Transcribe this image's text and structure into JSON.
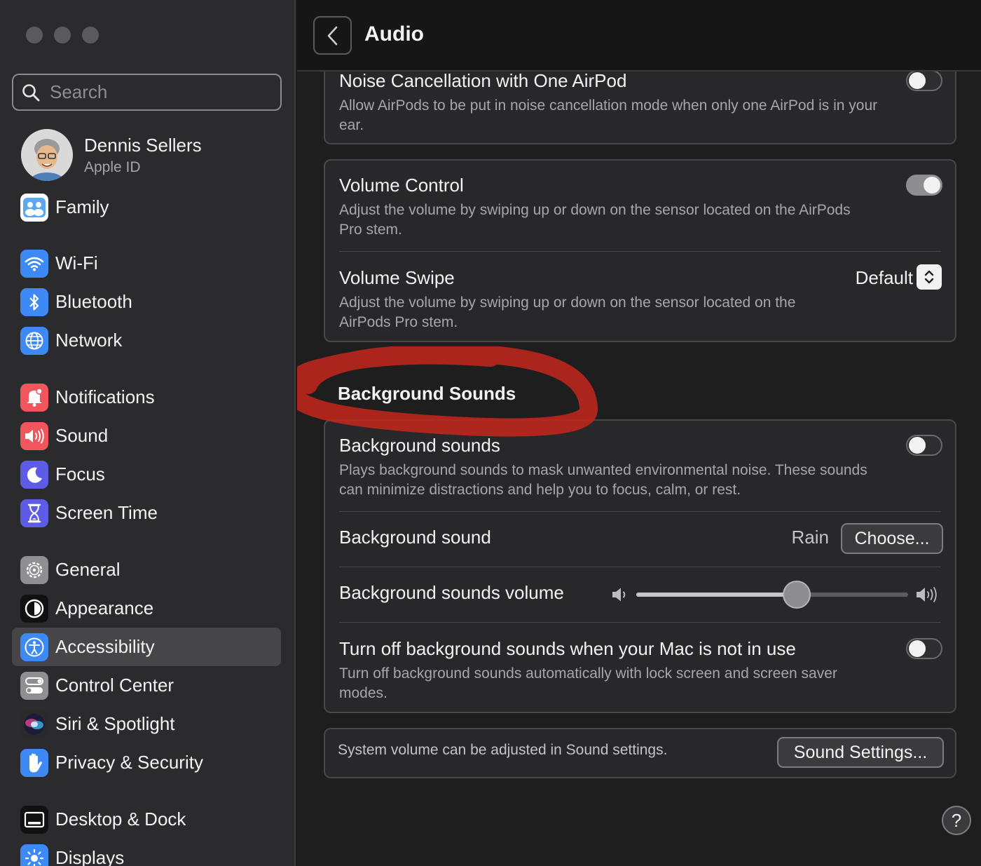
{
  "window": {
    "traffic_lights": [
      "close",
      "minimize",
      "zoom"
    ]
  },
  "sidebar": {
    "search_placeholder": "Search",
    "profile": {
      "name": "Dennis Sellers",
      "subtitle": "Apple ID"
    },
    "items": [
      {
        "label": "Family",
        "icon": "family-icon",
        "color": "#4a9df5"
      },
      {
        "label": "Wi-Fi",
        "icon": "wifi-icon",
        "color": "#3d8af7"
      },
      {
        "label": "Bluetooth",
        "icon": "bluetooth-icon",
        "color": "#3d8af7"
      },
      {
        "label": "Network",
        "icon": "globe-icon",
        "color": "#3d8af7"
      },
      {
        "label": "Notifications",
        "icon": "bell-icon",
        "color": "#f0565b"
      },
      {
        "label": "Sound",
        "icon": "speaker-icon",
        "color": "#f0565b"
      },
      {
        "label": "Focus",
        "icon": "moon-icon",
        "color": "#5e5ce6"
      },
      {
        "label": "Screen Time",
        "icon": "hourglass-icon",
        "color": "#5e5ce6"
      },
      {
        "label": "General",
        "icon": "gear-icon",
        "color": "#8e8e93"
      },
      {
        "label": "Appearance",
        "icon": "appearance-icon",
        "color": "#1c1c1e"
      },
      {
        "label": "Accessibility",
        "icon": "accessibility-icon",
        "color": "#3d8af7",
        "selected": true
      },
      {
        "label": "Control Center",
        "icon": "control-center-icon",
        "color": "#8e8e93"
      },
      {
        "label": "Siri & Spotlight",
        "icon": "siri-icon",
        "color": "#2a2a2c"
      },
      {
        "label": "Privacy & Security",
        "icon": "hand-icon",
        "color": "#3d8af7"
      },
      {
        "label": "Desktop & Dock",
        "icon": "dock-icon",
        "color": "#1c1c1e"
      },
      {
        "label": "Displays",
        "icon": "sun-icon",
        "color": "#3d8af7"
      }
    ]
  },
  "main": {
    "title": "Audio",
    "noise": {
      "title": "Noise Cancellation with One AirPod",
      "desc": "Allow AirPods to be put in noise cancellation mode when only one AirPod is in your ear.",
      "on": false
    },
    "volume_control": {
      "title": "Volume Control",
      "desc": "Adjust the volume by swiping up or down on the sensor located on the AirPods Pro stem.",
      "on": true
    },
    "volume_swipe": {
      "title": "Volume Swipe",
      "desc": "Adjust the volume by swiping up or down on the sensor located on the AirPods Pro stem.",
      "value": "Default"
    },
    "bg_section_title": "Background Sounds",
    "bg_toggle": {
      "title": "Background sounds",
      "desc": "Plays background sounds to mask unwanted environmental noise. These sounds can minimize distractions and help you to focus, calm, or rest.",
      "on": false
    },
    "bg_sound": {
      "title": "Background sound",
      "value": "Rain",
      "button": "Choose..."
    },
    "bg_volume": {
      "title": "Background sounds volume",
      "level": 0.59
    },
    "bg_turnoff": {
      "title": "Turn off background sounds when your Mac is not in use",
      "desc": "Turn off background sounds automatically with lock screen and screen saver modes.",
      "on": false
    },
    "footer": {
      "text": "System volume can be adjusted in Sound settings.",
      "button": "Sound Settings..."
    },
    "help": "?",
    "annotation_color": "#c0271c"
  }
}
